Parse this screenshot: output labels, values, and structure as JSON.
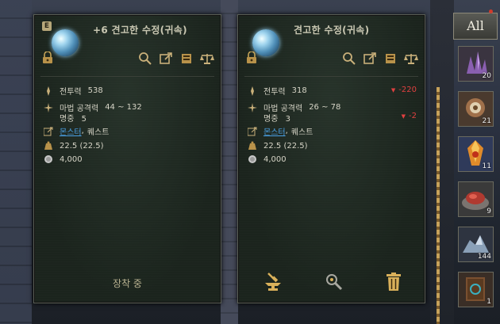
{
  "compare_panels": [
    {
      "grade_badge": "E",
      "title": "+6 견고한 수정(귀속)",
      "combat_power_label": "전투력",
      "combat_power_value": "538",
      "magic_attack_label": "마법 공격력",
      "magic_attack_value": "44 ~ 132",
      "accuracy_label": "명중",
      "accuracy_value": "5",
      "source_link": "몬스터",
      "source_sep": ",",
      "source_rest": "퀘스트",
      "weight": "22.5 (22.5)",
      "price": "4,000",
      "footer_status": "장착 중"
    },
    {
      "title": "견고한 수정(귀속)",
      "combat_power_label": "전투력",
      "combat_power_value": "318",
      "combat_power_diff": "-220",
      "magic_attack_label": "마법 공격력",
      "magic_attack_value": "26 ~ 78",
      "accuracy_label": "명중",
      "accuracy_value": "3",
      "accuracy_diff": "-2",
      "source_link": "몬스터",
      "source_sep": ",",
      "source_rest": "퀘스트",
      "weight": "22.5 (22.5)",
      "price": "4,000",
      "actions": [
        "anvil-icon",
        "search-gear-icon",
        "trash-icon"
      ]
    }
  ],
  "inventory": {
    "filter_label": "All",
    "slots": [
      {
        "icon": "crystal-cluster-icon",
        "count": "20"
      },
      {
        "icon": "gear-ore-icon",
        "count": "21"
      },
      {
        "icon": "fire-gem-icon",
        "count": "11"
      },
      {
        "icon": "red-ore-icon",
        "count": "9"
      },
      {
        "icon": "silver-ore-icon",
        "count": "144"
      },
      {
        "icon": "rune-book-icon",
        "count": "1"
      }
    ]
  },
  "colors": {
    "panel_bg": "#1f2a21",
    "link": "#4ba2e8",
    "negative": "#e04040",
    "badge": "#d23b2b"
  }
}
